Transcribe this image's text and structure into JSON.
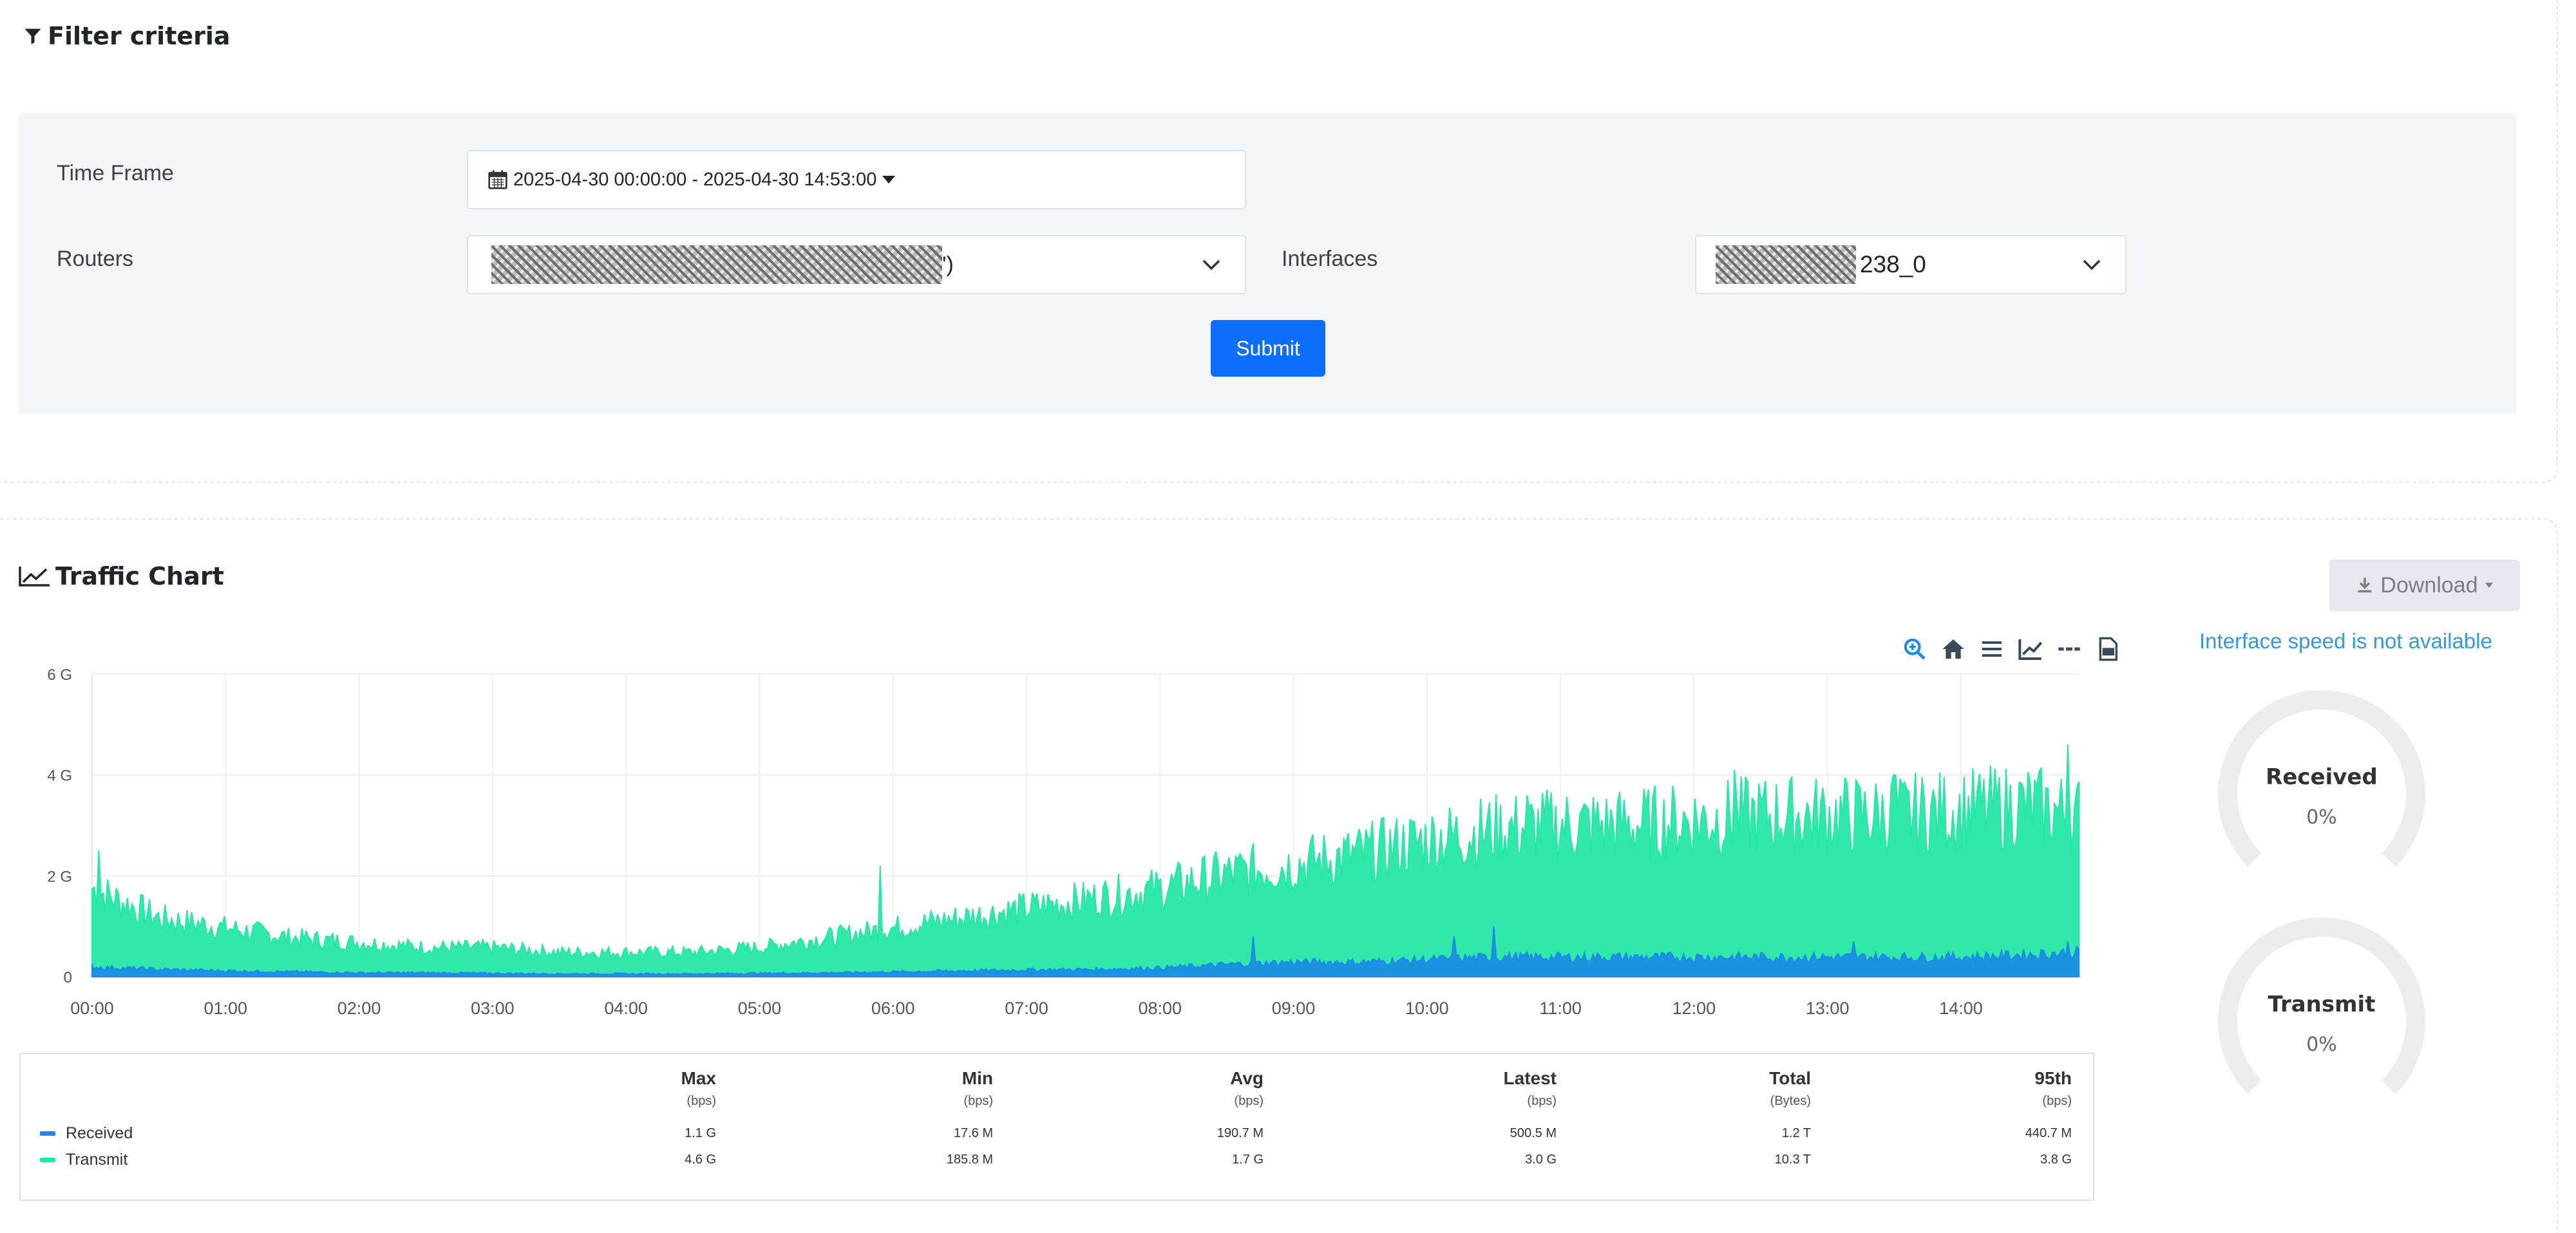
{
  "filter": {
    "title": "Filter criteria",
    "time_frame_label": "Time Frame",
    "time_frame_value": "2025-04-30 00:00:00 - 2025-04-30 14:53:00",
    "routers_label": "Routers",
    "routers_value_suffix": "')",
    "interfaces_label": "Interfaces",
    "interfaces_value_suffix": "238_0",
    "submit_label": "Submit"
  },
  "traffic": {
    "title": "Traffic Chart",
    "download_label": "Download",
    "toolbar_icons": [
      "zoom-icon",
      "home-icon",
      "menu-icon",
      "line-chart-icon",
      "dash-icon",
      "pdf-icon"
    ]
  },
  "speed_note": "Interface speed is not available",
  "gauges": [
    {
      "title": "Received",
      "value": "0%"
    },
    {
      "title": "Transmit",
      "value": "0%"
    }
  ],
  "colors": {
    "received": "#1a8be6",
    "transmit": "#26e7a6",
    "accent": "#0d6efd",
    "note": "#3498db"
  },
  "chart_data": {
    "type": "area",
    "title": "",
    "xlabel": "",
    "ylabel": "",
    "y_ticks": [
      "0",
      "2 G",
      "4 G",
      "6 G"
    ],
    "y_tick_values": [
      0,
      2,
      4,
      6
    ],
    "ylim": [
      0,
      6
    ],
    "y_unit": "G",
    "x_ticks": [
      "00:00",
      "01:00",
      "02:00",
      "03:00",
      "04:00",
      "05:00",
      "06:00",
      "07:00",
      "08:00",
      "09:00",
      "10:00",
      "11:00",
      "12:00",
      "13:00",
      "14:00"
    ],
    "xlim_hours": [
      0,
      14.883
    ],
    "grid": true,
    "series": [
      {
        "name": "Transmit",
        "color": "#26e7a6",
        "x": [
          0,
          0.5,
          1,
          1.5,
          2,
          2.5,
          3,
          3.5,
          4,
          4.5,
          5,
          5.5,
          6,
          6.5,
          7,
          7.5,
          8,
          8.5,
          9,
          9.5,
          10,
          10.5,
          11,
          11.5,
          12,
          12.5,
          13,
          13.5,
          14,
          14.5,
          14.883
        ],
        "values": [
          1.8,
          1.2,
          1.0,
          0.8,
          0.7,
          0.6,
          0.6,
          0.5,
          0.5,
          0.5,
          0.6,
          0.8,
          1.0,
          1.2,
          1.4,
          1.6,
          1.8,
          2.1,
          2.3,
          2.5,
          2.8,
          3.0,
          3.1,
          3.1,
          3.2,
          3.3,
          3.3,
          3.3,
          3.4,
          3.5,
          3.3
        ],
        "peaks": [
          [
            0.05,
            2.5
          ],
          [
            5.9,
            2.2
          ],
          [
            10.75,
            3.6
          ],
          [
            12.3,
            4.1
          ],
          [
            13.5,
            4.0
          ],
          [
            14.8,
            4.6
          ]
        ]
      },
      {
        "name": "Received",
        "color": "#1a8be6",
        "x": [
          0,
          0.5,
          1,
          1.5,
          2,
          2.5,
          3,
          3.5,
          4,
          4.5,
          5,
          5.5,
          6,
          6.5,
          7,
          7.5,
          8,
          8.5,
          9,
          9.5,
          10,
          10.5,
          11,
          11.5,
          12,
          12.5,
          13,
          13.5,
          14,
          14.5,
          14.883
        ],
        "values": [
          0.2,
          0.15,
          0.12,
          0.1,
          0.08,
          0.08,
          0.07,
          0.06,
          0.06,
          0.06,
          0.07,
          0.08,
          0.1,
          0.12,
          0.14,
          0.15,
          0.18,
          0.25,
          0.3,
          0.3,
          0.35,
          0.4,
          0.4,
          0.4,
          0.4,
          0.4,
          0.4,
          0.4,
          0.4,
          0.45,
          0.5
        ],
        "peaks": [
          [
            8.7,
            0.8
          ],
          [
            10.5,
            1.0
          ],
          [
            10.2,
            0.8
          ],
          [
            13.2,
            0.7
          ],
          [
            14.8,
            0.7
          ]
        ]
      }
    ]
  },
  "stats": {
    "columns": [
      {
        "h": "Max",
        "u": "(bps)"
      },
      {
        "h": "Min",
        "u": "(bps)"
      },
      {
        "h": "Avg",
        "u": "(bps)"
      },
      {
        "h": "Latest",
        "u": "(bps)"
      },
      {
        "h": "Total",
        "u": "(Bytes)"
      },
      {
        "h": "95th",
        "u": "(bps)"
      }
    ],
    "rows": [
      {
        "name": "Received",
        "cells": [
          "1.1 G",
          "17.6 M",
          "190.7 M",
          "500.5 M",
          "1.2 T",
          "440.7 M"
        ]
      },
      {
        "name": "Transmit",
        "cells": [
          "4.6 G",
          "185.8 M",
          "1.7 G",
          "3.0 G",
          "10.3 T",
          "3.8 G"
        ]
      }
    ]
  }
}
